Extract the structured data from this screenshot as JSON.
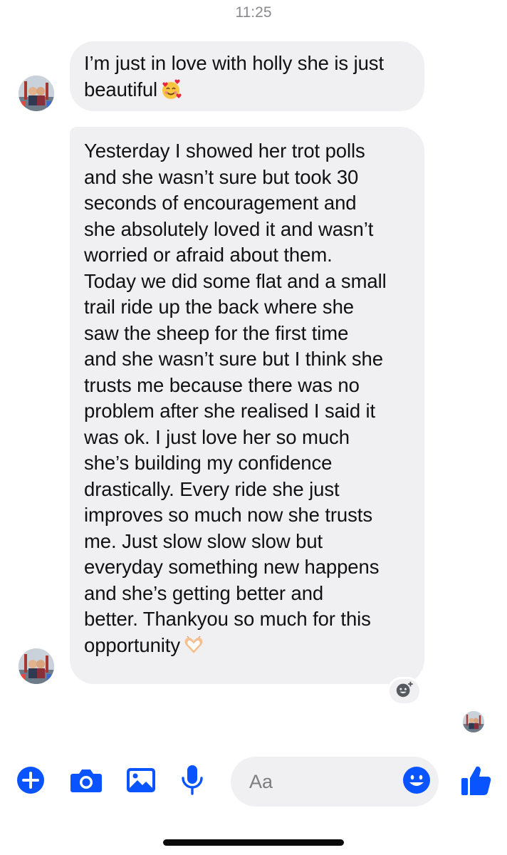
{
  "status_bar": {
    "time": "11:25"
  },
  "messages": [
    {
      "text": "I’m just in love with holly she is just\nbeautiful",
      "emoji": "smiling-face-with-hearts-emoji"
    },
    {
      "text": "Yesterday I showed her trot polls\nand she wasn’t sure but took 30\nseconds of encouragement and\nshe absolutely loved it and wasn’t\nworried or afraid about them.\nToday we did some flat and a small\ntrail ride up the back where she\nsaw the sheep for the first time\nand she wasn’t sure but I think she\ntrusts me because there was no\nproblem after she realised I said it\nwas ok. I just love her so much\nshe’s building my confidence\ndrastically. Every ride she just\nimproves so much now she trusts\nme. Just slow slow slow but\neveryday something new happens\nand she’s getting better and\nbetter. Thankyou so much for this\nopportunity",
      "emoji": "heart-hands-emoji"
    }
  ],
  "composer": {
    "placeholder": "Aa",
    "value": "",
    "icons": [
      "plus-icon",
      "camera-icon",
      "image-icon",
      "microphone-icon",
      "emoji-icon",
      "thumbs-up-icon"
    ]
  },
  "colors": {
    "accent": "#0a54ff",
    "bubble_bg": "#f0f0f2",
    "timestamp": "#8a8a8e"
  }
}
